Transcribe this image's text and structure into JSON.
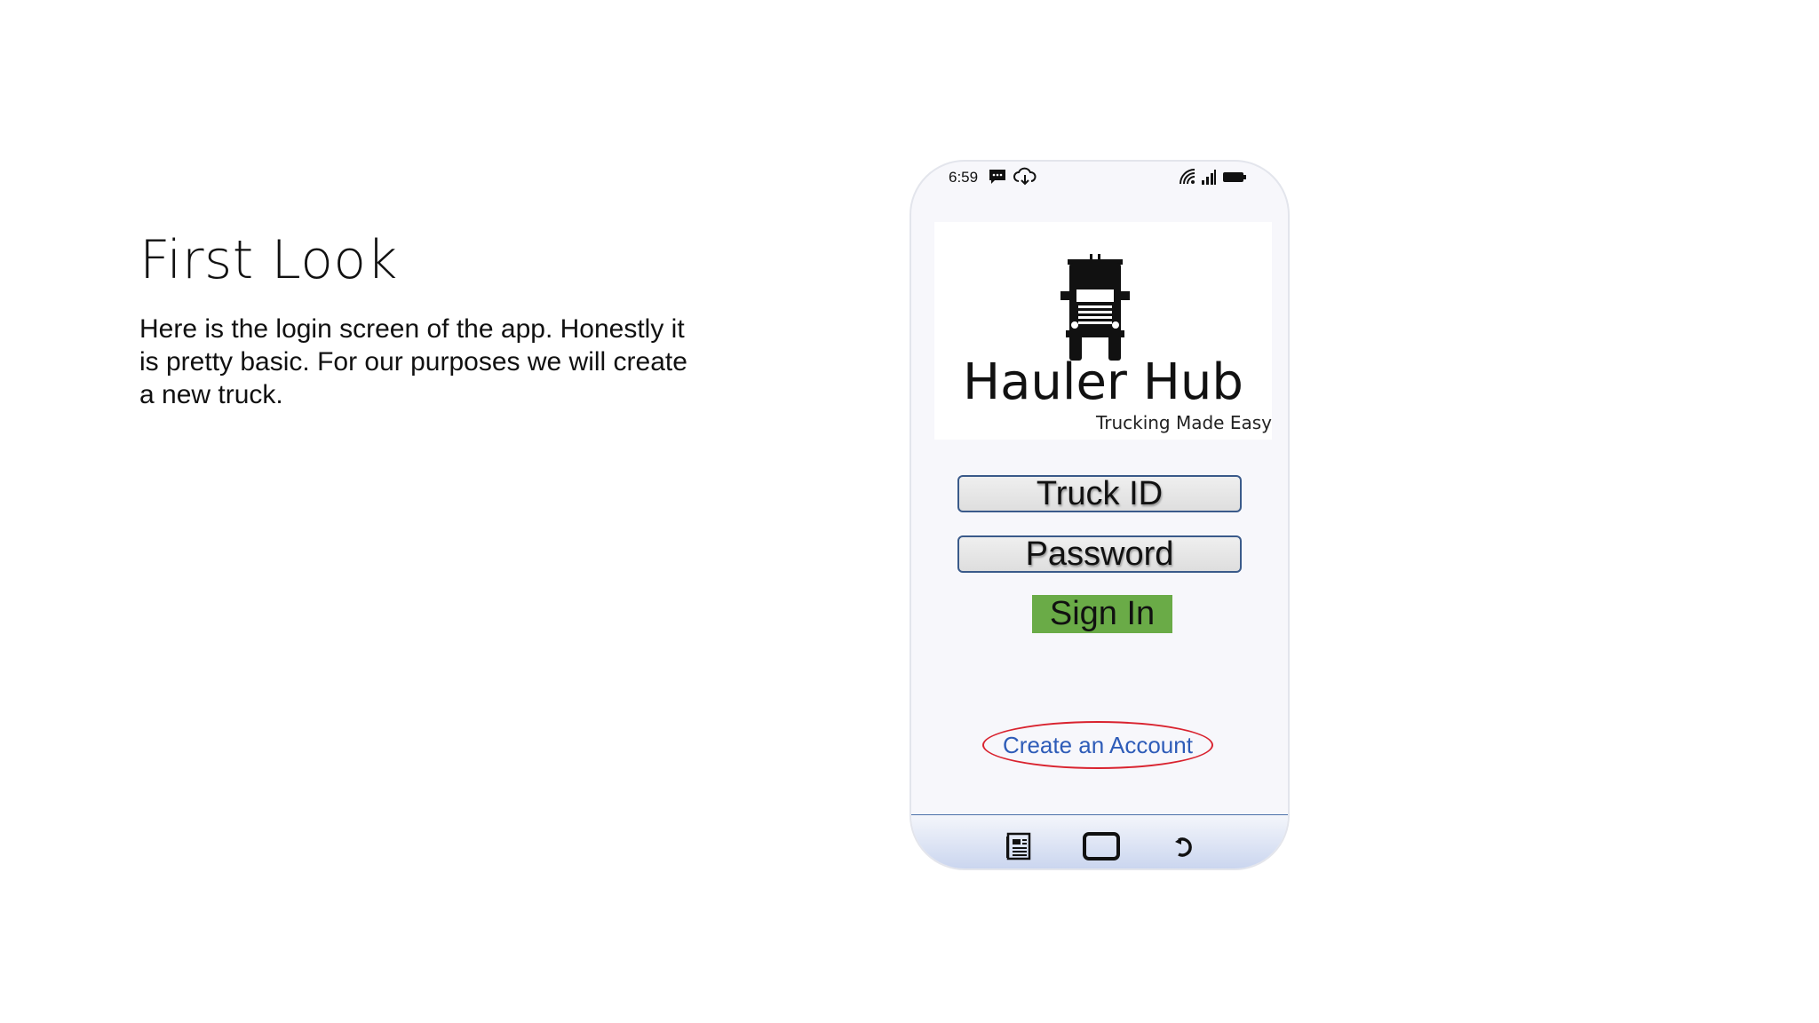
{
  "slide": {
    "title": "First Look",
    "body": "Here is the login screen of the app. Honestly it is pretty basic. For our purposes we will create a new truck."
  },
  "phone": {
    "status_bar": {
      "time": "6:59",
      "icons": [
        "message-icon",
        "cloud-download-icon",
        "wifi-icon",
        "signal-icon",
        "battery-icon"
      ]
    },
    "logo": {
      "name": "Hauler Hub",
      "tagline": "Trucking Made Easy",
      "icon": "semi-truck-icon"
    },
    "form": {
      "truck_id_placeholder": "Truck ID",
      "password_placeholder": "Password",
      "sign_in_label": "Sign In"
    },
    "create_account_label": "Create an Account",
    "nav_bar": {
      "icons": [
        "recent-apps-icon",
        "home-icon",
        "back-icon"
      ]
    },
    "colors": {
      "sign_in_bg": "#6aab47",
      "highlight_ellipse": "#d9232f",
      "link": "#2e5cb8",
      "field_border": "#3a5a8a"
    }
  }
}
